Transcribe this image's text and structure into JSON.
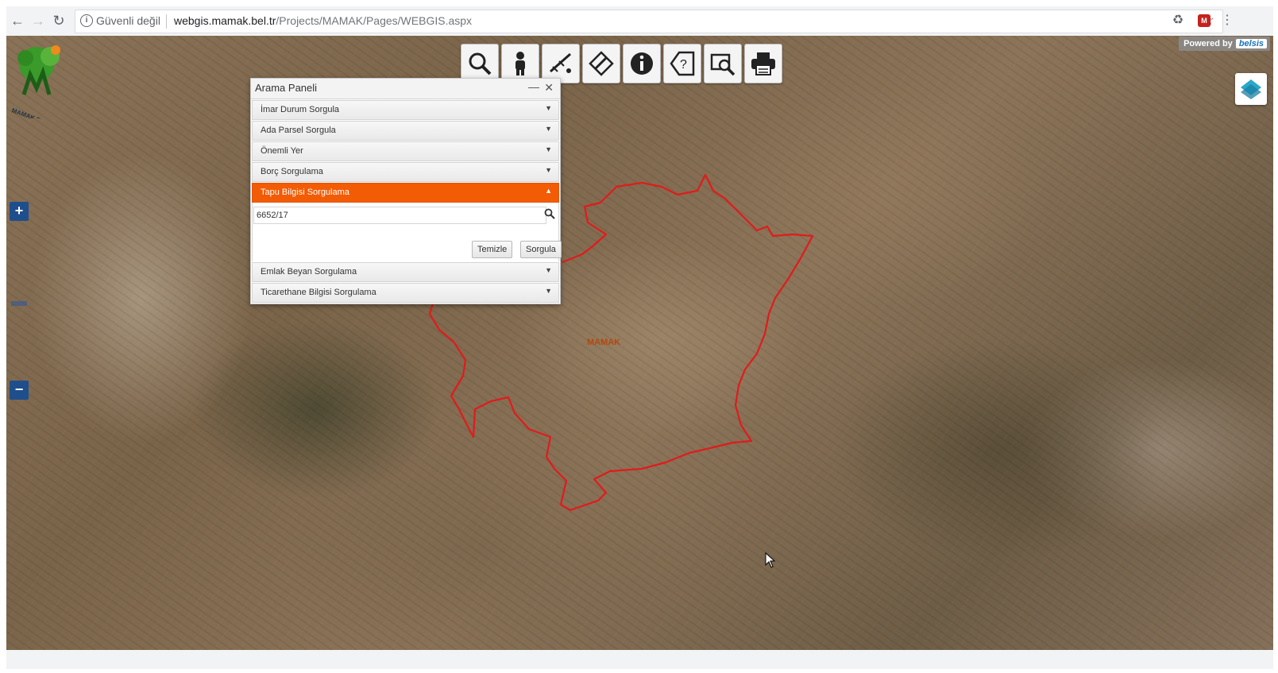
{
  "browser": {
    "security_label": "Güvenli değil",
    "url_host": "webgis.mamak.bel.tr",
    "url_path": "/Projects/MAMAK/Pages/WEBGIS.aspx",
    "back_icon": "back-arrow-icon",
    "forward_icon": "forward-arrow-icon",
    "reload_icon": "reload-icon",
    "star_icon": "star-icon"
  },
  "map": {
    "powered_by": "Powered by",
    "brand": "belsis",
    "place_label": "MAMAK",
    "logo_text": "MAMAK BELEDİYESİ",
    "boundary_color": "#e11b1b",
    "zoom_in": "+",
    "zoom_out": "−"
  },
  "toolbar": {
    "tools": [
      {
        "icon": "search-icon"
      },
      {
        "icon": "person-icon"
      },
      {
        "icon": "measure-icon"
      },
      {
        "icon": "draw-icon"
      },
      {
        "icon": "info-icon"
      },
      {
        "icon": "help-icon"
      },
      {
        "icon": "zoom-window-icon"
      },
      {
        "icon": "print-icon"
      }
    ]
  },
  "panel": {
    "title": "Arama Paneli",
    "sections": [
      "İmar Durum Sorgula",
      "Ada Parsel Sorgula",
      "Önemli Yer",
      "Borç Sorgulama",
      "Tapu Bilgisi Sorgulama",
      "Emlak Beyan Sorgulama",
      "Ticarethane Bilgisi Sorgulama"
    ],
    "active_section": "Tapu Bilgisi Sorgulama",
    "accent_color": "#f25c05",
    "query_value": "6652/17",
    "clear_label": "Temizle",
    "query_label": "Sorgula"
  }
}
